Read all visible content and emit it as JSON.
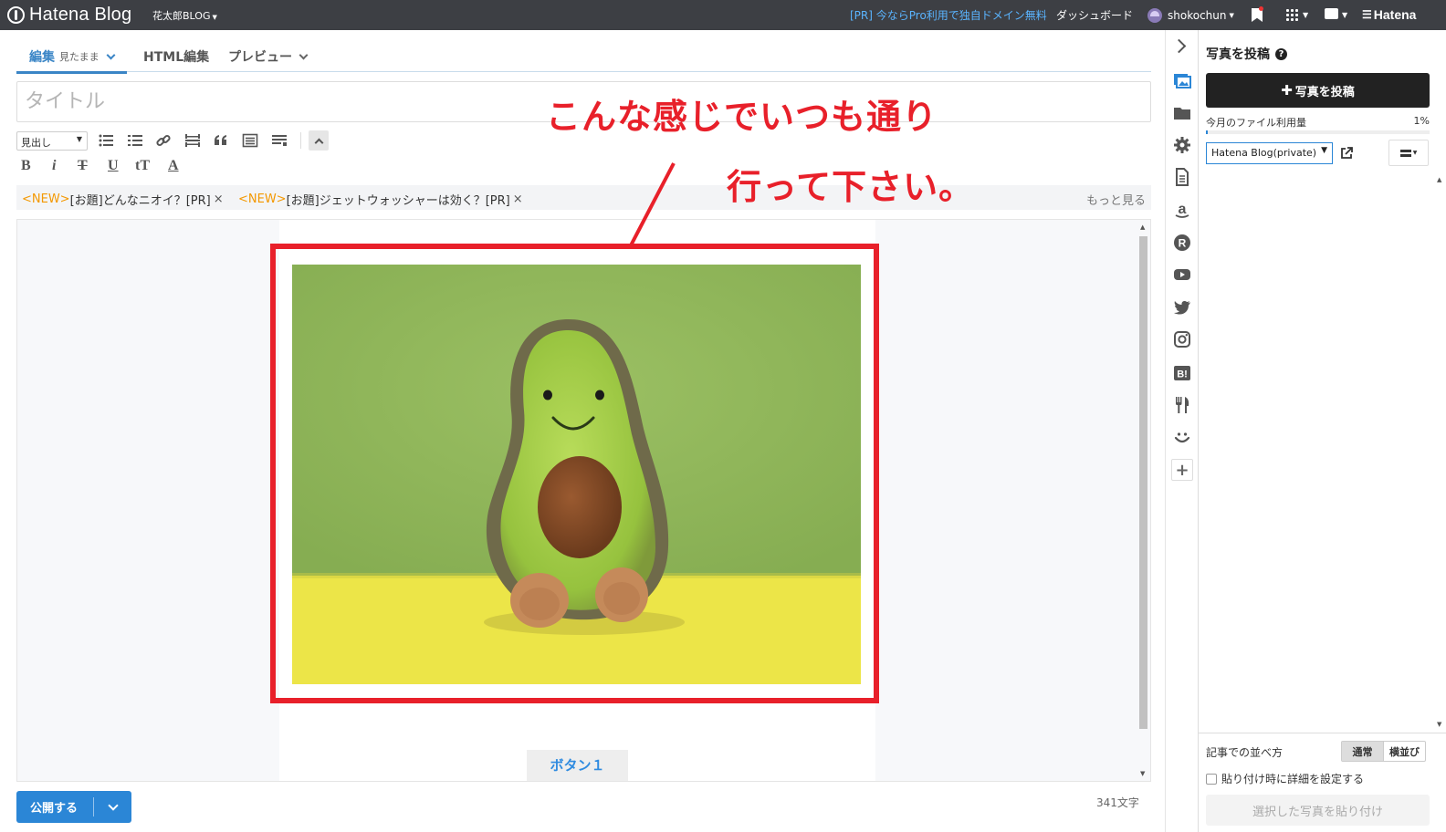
{
  "topbar": {
    "logo_text": "Hatena Blog",
    "blog_name": "花太郎BLOG",
    "pr_link": "[PR] 今ならPro利用で独自ドメイン無料",
    "dashboard": "ダッシュボード",
    "username": "shokochun",
    "hatena": "Hatena"
  },
  "tabs": {
    "edit": "編集",
    "edit_mode": "見たまま",
    "html": "HTML編集",
    "preview": "プレビュー"
  },
  "title_placeholder": "タイトル",
  "toolbar": {
    "heading_select": "見出し",
    "format_buttons": [
      "B",
      "i",
      "T",
      "U",
      "tT",
      "A"
    ]
  },
  "topics": {
    "items": [
      {
        "new": "<NEW>",
        "label": "[お題]どんなニオイ？[PR]",
        "close": "×"
      },
      {
        "new": "<NEW>",
        "label": "[お題]ジェットウォッシャーは効く？[PR]",
        "close": "×"
      }
    ],
    "more": "もっと見る"
  },
  "content": {
    "button1": "ボタン１",
    "annotation_line1": "こんな感じでいつも通り",
    "annotation_line2": "行って下さい。"
  },
  "footer": {
    "publish": "公開する",
    "char_count": "341文字"
  },
  "panel": {
    "title": "写真を投稿",
    "help": "?",
    "post_button": "写真を投稿",
    "usage_label": "今月のファイル利用量",
    "usage_percent": "1%",
    "usage_value": 0.01,
    "blog_select": "Hatena Blog(private)",
    "arrange_label": "記事での並べ方",
    "arrange_options": [
      "通常",
      "横並び"
    ],
    "detail_checkbox": "貼り付け時に詳細を設定する",
    "paste_button": "選択した写真を貼り付け"
  },
  "colors": {
    "topbar_bg": "#3d3f44",
    "accent_blue": "#2b86d6",
    "annotation_red": "#e8202a",
    "topic_new": "#f39800"
  },
  "rail_icons": [
    "photo-icon",
    "folder-icon",
    "gear-icon",
    "document-icon",
    "amazon-icon",
    "rakuten-icon",
    "youtube-icon",
    "twitter-icon",
    "instagram-icon",
    "hatena-bookmark-icon",
    "restaurant-icon",
    "smile-icon",
    "plus-icon"
  ]
}
